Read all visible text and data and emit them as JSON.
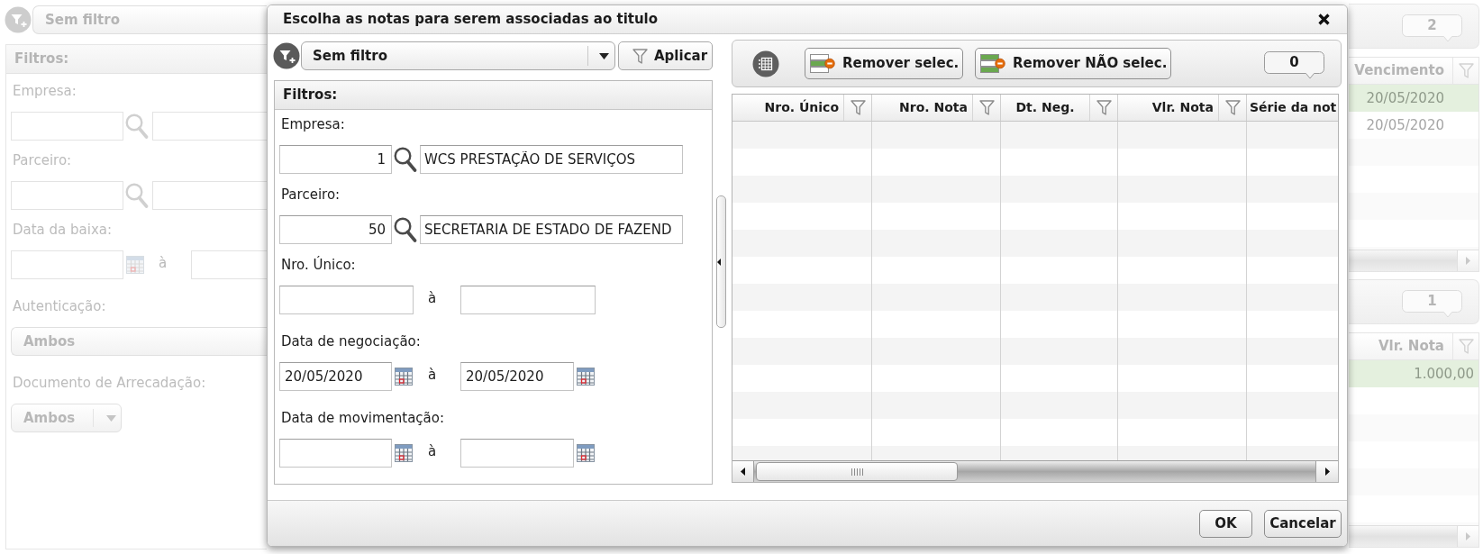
{
  "background": {
    "left_panel": {
      "filter_select": "Sem filtro",
      "filters_title": "Filtros:",
      "fields": [
        {
          "kind": "lookup",
          "label": "Empresa:"
        },
        {
          "kind": "lookup",
          "label": "Parceiro:"
        },
        {
          "kind": "date_range",
          "label": "Data da baixa:",
          "separator": "à"
        },
        {
          "kind": "select",
          "label": "Autenticação:",
          "value": "Ambos"
        },
        {
          "kind": "dropdown",
          "label": "Documento de Arrecadação:",
          "value": "Ambos"
        }
      ]
    },
    "right_panel": {
      "grids": [
        {
          "counter": "2",
          "column": {
            "label": "Vencimento",
            "kind": "date",
            "filter": true
          },
          "rows": [
            {
              "value": "20/05/2020",
              "selected": true
            },
            {
              "value": "20/05/2020",
              "selected": false
            }
          ]
        },
        {
          "counter": "1",
          "column": {
            "label": "Vlr. Nota",
            "kind": "number",
            "filter": true
          },
          "rows": [
            {
              "value": "1.000,00",
              "selected": true
            }
          ]
        }
      ]
    }
  },
  "dialog": {
    "title": "Escolha as notas para serem associadas ao titulo",
    "filter_bar": {
      "select": "Sem filtro",
      "apply_button": "Aplicar"
    },
    "filters": {
      "title": "Filtros:",
      "fields": [
        {
          "kind": "lookup",
          "label": "Empresa:",
          "code": "1",
          "name": "WCS PRESTAÇÃO DE SERVIÇOS"
        },
        {
          "kind": "lookup",
          "label": "Parceiro:",
          "code": "50",
          "name": "SECRETARIA DE ESTADO DE FAZEND"
        },
        {
          "kind": "range",
          "label": "Nro. Único:",
          "separator": "à"
        },
        {
          "kind": "date_range",
          "label": "Data de negociação:",
          "from": "20/05/2020",
          "separator": "à",
          "to": "20/05/2020"
        },
        {
          "kind": "date_range",
          "label": "Data de movimentação:",
          "separator": "à"
        }
      ]
    },
    "toolbar": {
      "buttons": [
        {
          "kind": "selected",
          "label": "Remover selec."
        },
        {
          "kind": "unselected",
          "label": "Remover NÃO selec."
        }
      ],
      "counter": "0"
    },
    "table": {
      "columns": [
        {
          "label": "Nro. Único",
          "kind": "number",
          "filter": true
        },
        {
          "label": "Nro. Nota",
          "kind": "number",
          "filter": true
        },
        {
          "label": "Dt. Neg.",
          "kind": "date",
          "filter": true
        },
        {
          "label": "Vlr. Nota",
          "kind": "number",
          "filter": true
        },
        {
          "label": "Série da not",
          "kind": "text",
          "filter": false
        }
      ]
    },
    "buttons": [
      "OK",
      "Cancelar"
    ]
  }
}
